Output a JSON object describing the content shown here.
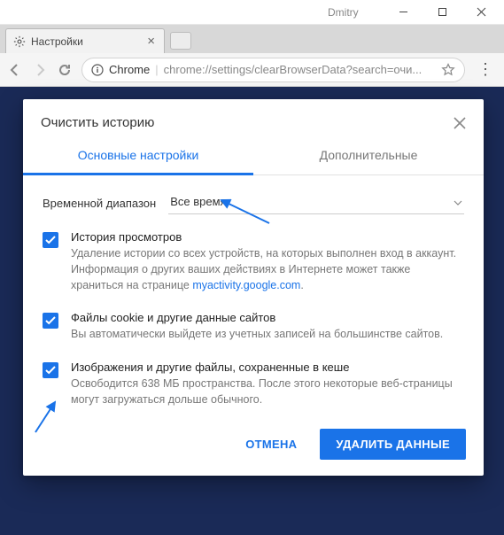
{
  "window": {
    "user": "Dmitry"
  },
  "tab": {
    "title": "Настройки"
  },
  "omnibox": {
    "origin_label": "Chrome",
    "origin": "chrome://settings/",
    "path": "clearBrowserData?search=очи..."
  },
  "modal": {
    "title": "Очистить историю",
    "tabs": {
      "basic": "Основные настройки",
      "advanced": "Дополнительные"
    },
    "range": {
      "label": "Временной диапазон",
      "value": "Все время"
    },
    "options": [
      {
        "checked": true,
        "title": "История просмотров",
        "desc_prefix": "Удаление истории со всех устройств, на которых выполнен вход в аккаунт. Информация о других ваших действиях в Интернете может также храниться на странице ",
        "desc_link": "myactivity.google.com",
        "desc_suffix": "."
      },
      {
        "checked": true,
        "title": "Файлы cookie и другие данные сайтов",
        "desc_prefix": "Вы автоматически выйдете из учетных записей на большинстве сайтов.",
        "desc_link": "",
        "desc_suffix": ""
      },
      {
        "checked": true,
        "title": "Изображения и другие файлы, сохраненные в кеше",
        "desc_prefix": "Освободится 638 МБ пространства. После этого некоторые веб-страницы могут загружаться дольше обычного.",
        "desc_link": "",
        "desc_suffix": ""
      }
    ],
    "actions": {
      "cancel": "ОТМЕНА",
      "confirm": "УДАЛИТЬ ДАННЫЕ"
    }
  }
}
